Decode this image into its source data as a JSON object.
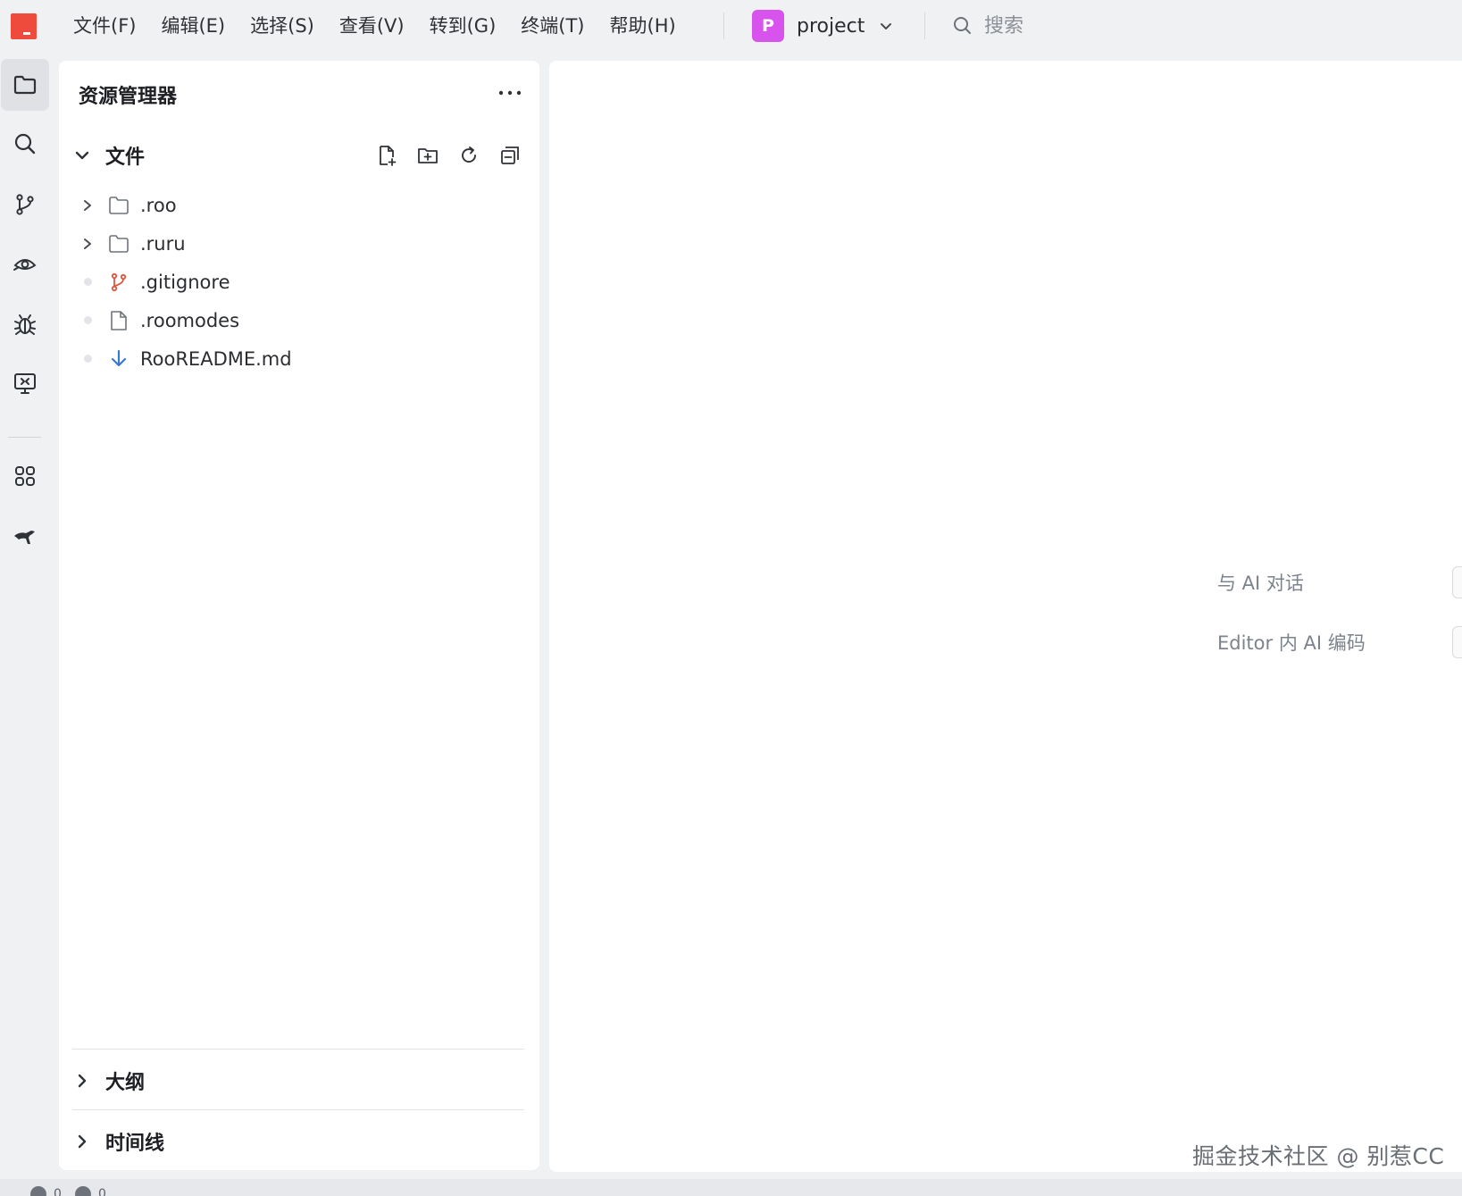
{
  "menubar": {
    "items": [
      "文件(F)",
      "编辑(E)",
      "选择(S)",
      "查看(V)",
      "转到(G)",
      "终端(T)",
      "帮助(H)"
    ],
    "project": {
      "avatar_letter": "P",
      "name": "project",
      "avatar_color": "#d853ee"
    },
    "search_placeholder": "搜索"
  },
  "activity_bar": {
    "items": [
      "folder-icon",
      "search-icon",
      "git-branch-icon",
      "eye-icon",
      "bug-icon",
      "remote-monitor-icon",
      "extensions-icon",
      "kangaroo-icon"
    ],
    "active": "folder-icon"
  },
  "explorer": {
    "title": "资源管理器",
    "files_section": {
      "label": "文件",
      "expanded": true
    },
    "tree": [
      {
        "name": ".roo",
        "type": "folder",
        "icon": "folder-icon"
      },
      {
        "name": ".ruru",
        "type": "folder",
        "icon": "folder-icon"
      },
      {
        "name": ".gitignore",
        "type": "file",
        "icon": "git-file-icon"
      },
      {
        "name": ".roomodes",
        "type": "file",
        "icon": "file-icon"
      },
      {
        "name": "RooREADME.md",
        "type": "file",
        "icon": "markdown-download-icon"
      }
    ],
    "outline_label": "大纲",
    "timeline_label": "时间线"
  },
  "editor": {
    "hint_chat": "与 AI 对话",
    "hint_inline": "Editor 内 AI 编码",
    "watermark": "掘金技术社区 @ 别惹CC"
  },
  "statusbar": {
    "errors": "0",
    "warnings": "0"
  },
  "colors": {
    "logo": "#ee4b3c",
    "git_icon": "#e0533f",
    "md_icon": "#3b78d6"
  }
}
